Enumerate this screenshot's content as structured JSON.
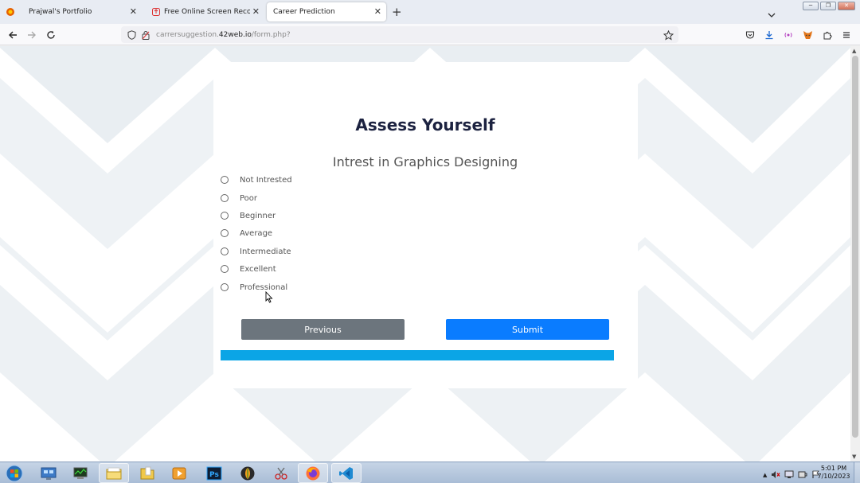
{
  "browser": {
    "tabs": [
      {
        "label": "Prajwal's Portfolio",
        "close": "✕"
      },
      {
        "label": "Free Online Screen Recorder &",
        "close": "✕"
      },
      {
        "label": "Career Prediction",
        "close": "✕"
      }
    ],
    "new_tab": "+",
    "url": {
      "prefix": "carrersuggestion.",
      "host": "42web.io",
      "path": "/form.php?"
    }
  },
  "page": {
    "title": "Assess Yourself",
    "question": "Intrest in Graphics Designing",
    "options": [
      "Not Intrested",
      "Poor",
      "Beginner",
      "Average",
      "Intermediate",
      "Excellent",
      "Professional"
    ],
    "buttons": {
      "previous": "Previous",
      "submit": "Submit"
    },
    "progress_fraction": 1.0,
    "colors": {
      "title": "#1c2240",
      "submit": "#0a7cff",
      "previous": "#6c757d",
      "progress": "#0ba5e6",
      "chevron": "#e9eef2"
    }
  },
  "taskbar": {
    "apps": [
      "start-orb",
      "control-panel",
      "task-manager",
      "file-explorer",
      "folder",
      "media-player",
      "photoshop",
      "fl-studio",
      "snipping-tool",
      "firefox",
      "vscode"
    ],
    "clock_time": "5:01 PM",
    "clock_date": "7/10/2023"
  }
}
